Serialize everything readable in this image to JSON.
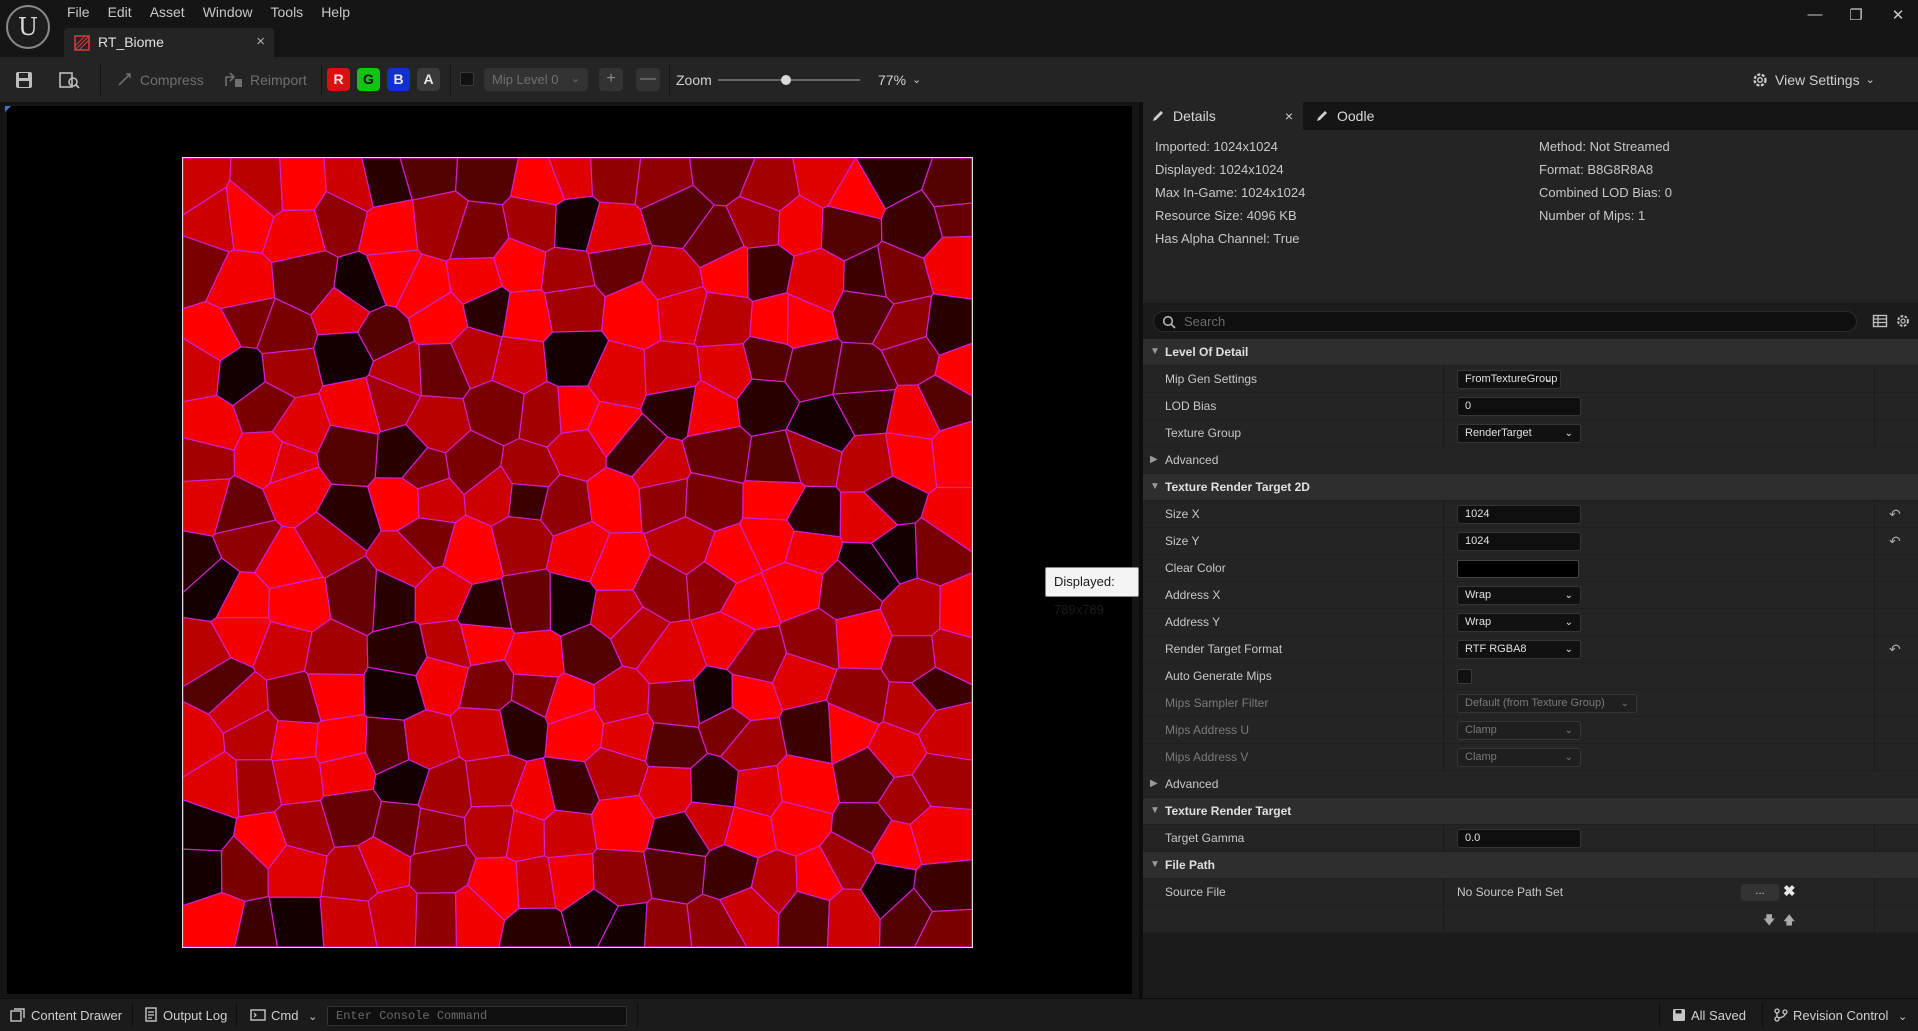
{
  "menu": [
    "File",
    "Edit",
    "Asset",
    "Window",
    "Tools",
    "Help"
  ],
  "asset_tab": {
    "label": "RT_Biome",
    "close": "×"
  },
  "window_controls": {
    "minimize": "—",
    "restore": "❐",
    "close": "✕"
  },
  "toolbar": {
    "compress": "Compress",
    "reimport": "Reimport",
    "channels": [
      {
        "label": "R",
        "color": "#d91010"
      },
      {
        "label": "G",
        "color": "#12c412"
      },
      {
        "label": "B",
        "color": "#1230cc"
      },
      {
        "label": "A",
        "color": "#3a3a3a"
      }
    ],
    "mip_level": "Mip Level 0",
    "plus": "+",
    "minus": "—",
    "zoom_label": "Zoom",
    "zoom_value": "77%",
    "zoom_slider_fraction": 0.48,
    "view_settings": "View Settings"
  },
  "viewport": {
    "tooltip": "Displayed: 789x789",
    "palette": [
      "#ff0000",
      "#f20000",
      "#e00000",
      "#cc0000",
      "#b80000",
      "#a30000",
      "#8f0000",
      "#7a0000",
      "#660000",
      "#520000",
      "#3d0000",
      "#290000",
      "#140000"
    ],
    "edge_color": "#d020d0"
  },
  "details": {
    "tab_details": "Details",
    "tab_oodle": "Oodle",
    "tab_close": "×",
    "info_left": [
      "Imported: 1024x1024",
      "Displayed: 1024x1024",
      "Max In-Game: 1024x1024",
      "Resource Size: 4096 KB",
      "Has Alpha Channel: True"
    ],
    "info_right": [
      "Method: Not Streamed",
      "Format: B8G8R8A8",
      "Combined LOD Bias: 0",
      "Number of Mips: 1"
    ],
    "search_placeholder": "Search",
    "rows": [
      {
        "kind": "cat",
        "label": "Level Of Detail"
      },
      {
        "kind": "combo",
        "label": "Mip Gen Settings",
        "value": "FromTextureGroup",
        "w": 104
      },
      {
        "kind": "input",
        "label": "LOD Bias",
        "value": "0"
      },
      {
        "kind": "combo",
        "label": "Texture Group",
        "value": "RenderTarget",
        "w": 124
      },
      {
        "kind": "adv",
        "label": "Advanced"
      },
      {
        "kind": "cat",
        "label": "Texture Render Target 2D"
      },
      {
        "kind": "input",
        "label": "Size X",
        "value": "1024",
        "reset": true
      },
      {
        "kind": "input",
        "label": "Size Y",
        "value": "1024",
        "reset": true
      },
      {
        "kind": "color",
        "label": "Clear Color"
      },
      {
        "kind": "combo",
        "label": "Address X",
        "value": "Wrap",
        "w": 124
      },
      {
        "kind": "combo",
        "label": "Address Y",
        "value": "Wrap",
        "w": 124
      },
      {
        "kind": "combo",
        "label": "Render Target Format",
        "value": "RTF RGBA8",
        "w": 124,
        "reset": true
      },
      {
        "kind": "check",
        "label": "Auto Generate Mips"
      },
      {
        "kind": "combo",
        "label": "Mips Sampler Filter",
        "value": "Default (from Texture Group)",
        "w": 180,
        "disabled": true
      },
      {
        "kind": "combo",
        "label": "Mips Address U",
        "value": "Clamp",
        "w": 124,
        "disabled": true
      },
      {
        "kind": "combo",
        "label": "Mips Address V",
        "value": "Clamp",
        "w": 124,
        "disabled": true
      },
      {
        "kind": "adv",
        "label": "Advanced"
      },
      {
        "kind": "cat",
        "label": "Texture Render Target"
      },
      {
        "kind": "input",
        "label": "Target Gamma",
        "value": "0.0"
      },
      {
        "kind": "cat",
        "label": "File Path"
      },
      {
        "kind": "file",
        "label": "Source File",
        "value": "No Source Path Set",
        "btn": "..."
      },
      {
        "kind": "arrows",
        "label": ""
      }
    ]
  },
  "statusbar": {
    "content_drawer": "Content Drawer",
    "output_log": "Output Log",
    "cmd": "Cmd",
    "console_placeholder": "Enter Console Command",
    "all_saved": "All Saved",
    "revision_control": "Revision Control"
  }
}
